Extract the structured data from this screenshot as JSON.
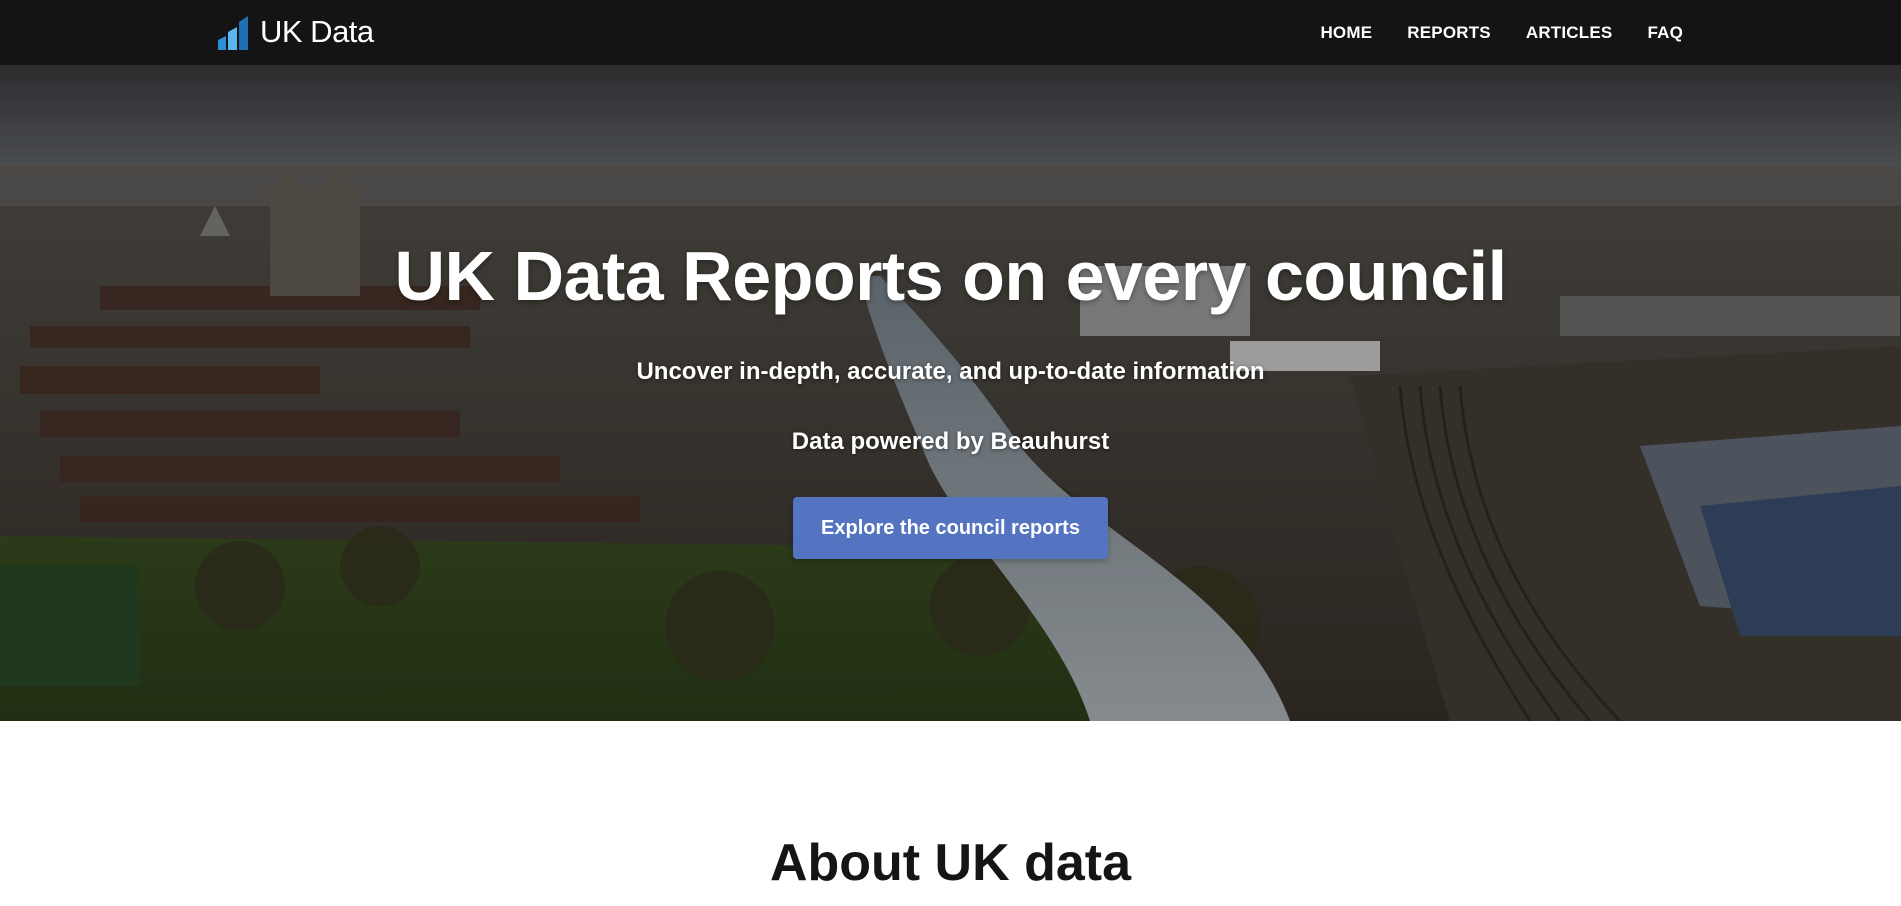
{
  "brand": {
    "name": "UK Data",
    "icon": "bar-chart-logo-icon",
    "icon_colors": [
      "#2a8fd6",
      "#5bb7ef",
      "#1f6fb4"
    ]
  },
  "nav": {
    "items": [
      {
        "label": "HOME"
      },
      {
        "label": "REPORTS"
      },
      {
        "label": "ARTICLES"
      },
      {
        "label": "FAQ"
      }
    ]
  },
  "hero": {
    "title": "UK Data Reports on every council",
    "subtitle": "Uncover in-depth, accurate, and up-to-date information",
    "powered_by": "Data powered by Beauhurst",
    "cta_label": "Explore the council reports",
    "cta_color": "#5474c2",
    "background_image": "aerial-city-river-photo"
  },
  "about": {
    "title": "About UK data"
  }
}
